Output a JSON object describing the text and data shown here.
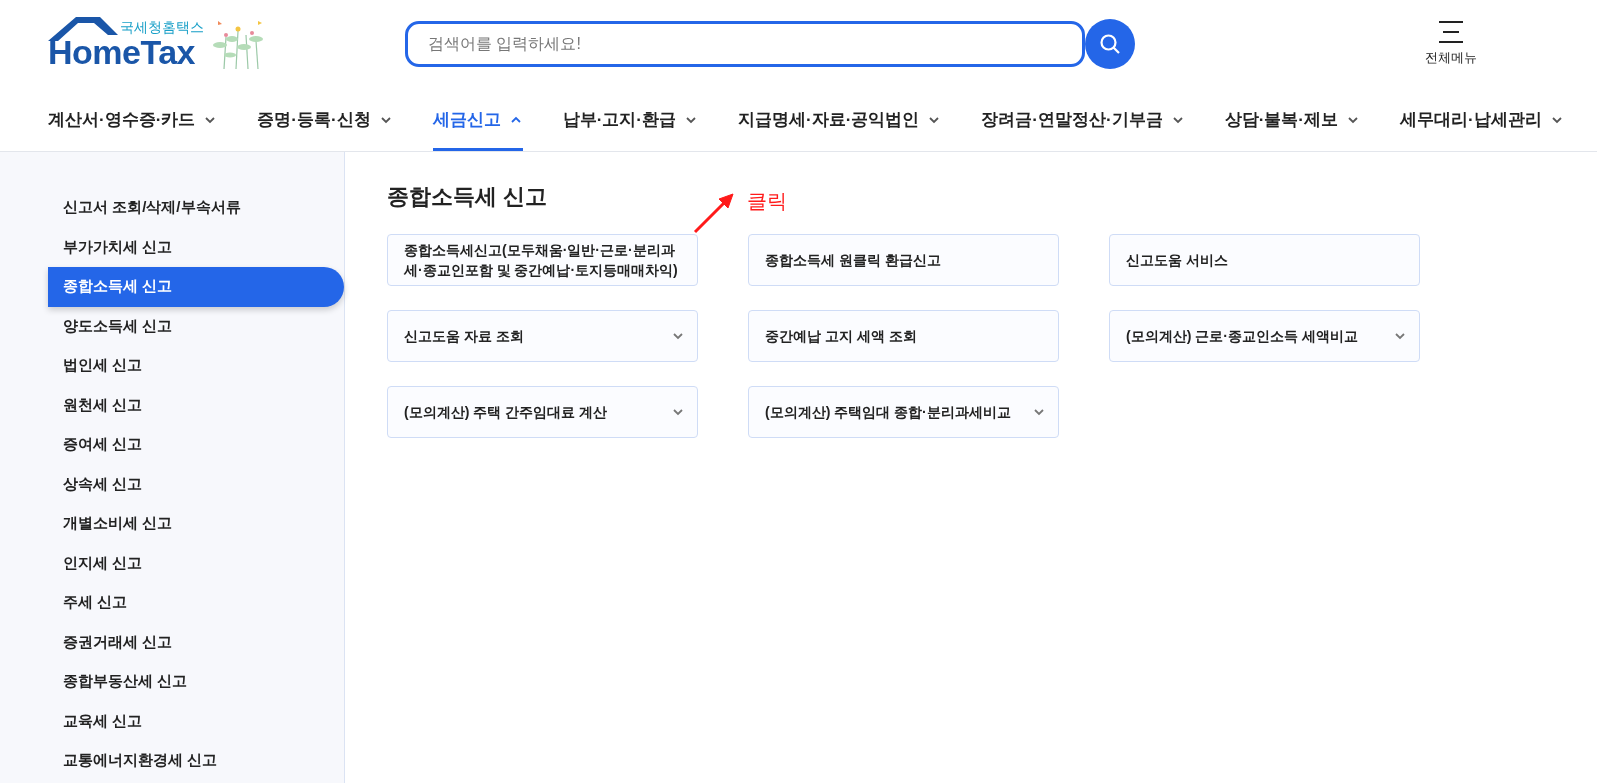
{
  "header": {
    "logo": {
      "subtitle": "국세청홈택스",
      "title": "HomeTax"
    },
    "search": {
      "placeholder": "검색어를 입력하세요!"
    },
    "menu_button": {
      "label": "전체메뉴"
    }
  },
  "nav": [
    {
      "label": "계산서·영수증·카드",
      "selected": false
    },
    {
      "label": "증명·등록·신청",
      "selected": false
    },
    {
      "label": "세금신고",
      "selected": true
    },
    {
      "label": "납부·고지·환급",
      "selected": false
    },
    {
      "label": "지급명세·자료·공익법인",
      "selected": false
    },
    {
      "label": "장려금·연말정산·기부금",
      "selected": false
    },
    {
      "label": "상담·불복·제보",
      "selected": false
    },
    {
      "label": "세무대리·납세관리",
      "selected": false
    }
  ],
  "sidebar": {
    "items": [
      {
        "label": "신고서 조회/삭제/부속서류",
        "selected": false
      },
      {
        "label": "부가가치세 신고",
        "selected": false
      },
      {
        "label": "종합소득세 신고",
        "selected": true
      },
      {
        "label": "양도소득세 신고",
        "selected": false
      },
      {
        "label": "법인세 신고",
        "selected": false
      },
      {
        "label": "원천세 신고",
        "selected": false
      },
      {
        "label": "증여세 신고",
        "selected": false
      },
      {
        "label": "상속세 신고",
        "selected": false
      },
      {
        "label": "개별소비세 신고",
        "selected": false
      },
      {
        "label": "인지세 신고",
        "selected": false
      },
      {
        "label": "주세 신고",
        "selected": false
      },
      {
        "label": "증권거래세 신고",
        "selected": false
      },
      {
        "label": "종합부동산세 신고",
        "selected": false
      },
      {
        "label": "교육세 신고",
        "selected": false
      },
      {
        "label": "교통에너지환경세 신고",
        "selected": false
      }
    ]
  },
  "main": {
    "title": "종합소득세 신고",
    "annotation": {
      "text": "클릭"
    },
    "cards": [
      {
        "label": "종합소득세신고(모두채움·일반·근로·분리과세·종교인포함 및 중간예납·토지등매매차익)",
        "kind": "link"
      },
      {
        "label": "종합소득세 원클릭 환급신고",
        "kind": "link"
      },
      {
        "label": "신고도움 서비스",
        "kind": "link"
      },
      {
        "label": "신고도움 자료 조회",
        "kind": "dropdown"
      },
      {
        "label": "중간예납 고지 세액 조회",
        "kind": "link"
      },
      {
        "label": "(모의계산) 근로·종교인소득 세액비교",
        "kind": "dropdown"
      },
      {
        "label": "(모의계산) 주택 간주임대료 계산",
        "kind": "dropdown"
      },
      {
        "label": "(모의계산) 주택임대 종합·분리과세비교",
        "kind": "dropdown"
      }
    ]
  }
}
